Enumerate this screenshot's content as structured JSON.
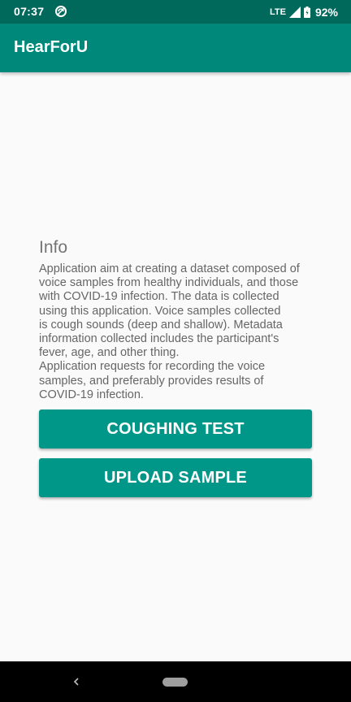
{
  "status_bar": {
    "time": "07:37",
    "network": "LTE",
    "battery": "92%",
    "icons": [
      "sync-icon",
      "signal-icon",
      "battery-icon"
    ]
  },
  "app_bar": {
    "title": "HearForU"
  },
  "info": {
    "heading": "Info",
    "lines": [
      "Application aim at creating a dataset composed of",
      "voice samples from healthy individuals, and those",
      "with COVID-19 infection. The data is collected",
      "using this application. Voice samples collected",
      "is cough sounds (deep and shallow). Metadata",
      "information collected includes the participant's",
      "fever, age, and other thing.",
      "Application requests for recording the voice",
      "samples, and preferably provides results of",
      "COVID-19 infection."
    ]
  },
  "buttons": {
    "coughing_test": "COUGHING TEST",
    "upload_sample": "UPLOAD SAMPLE"
  },
  "nav_bar": {
    "icons": [
      "back-icon",
      "home-pill-icon"
    ]
  },
  "colors": {
    "status_bar": "#00695c",
    "app_bar": "#00897b",
    "button": "#009688",
    "background": "#fafafa"
  }
}
